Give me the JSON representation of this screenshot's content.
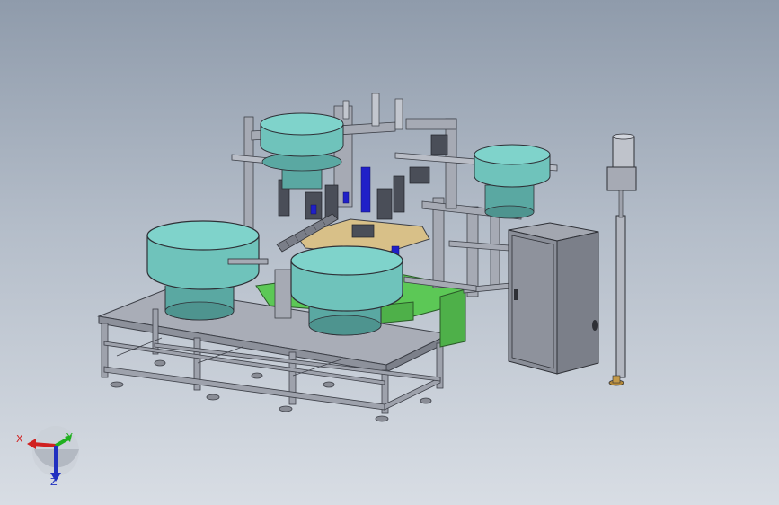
{
  "viewport": {
    "background_top": "#8f9bab",
    "background_bottom": "#d8dde4"
  },
  "model": {
    "bowl_color": "#6fc3bb",
    "frame_color": "#a6aab4",
    "base_green": "#5cc856",
    "cabinet_color": "#8a8e98",
    "accent_blue": "#2020c8",
    "platform_yellow": "#d8c088"
  },
  "triad": {
    "x_label": "X",
    "y_label": "Y",
    "z_label": "Z",
    "x_color": "#d02020",
    "y_color": "#20b020",
    "z_color": "#2030c0"
  }
}
